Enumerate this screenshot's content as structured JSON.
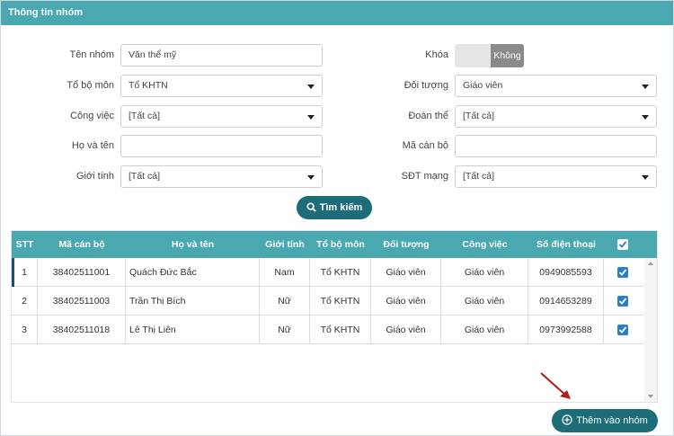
{
  "panel": {
    "title": "Thông tin nhóm"
  },
  "form": {
    "ten_nhom": {
      "label": "Tên nhóm",
      "value": "Văn thể mỹ"
    },
    "to_bo_mon": {
      "label": "Tổ bộ môn",
      "value": "Tổ KHTN"
    },
    "cong_viec": {
      "label": "Công việc",
      "value": "[Tất cả]"
    },
    "ho_va_ten": {
      "label": "Họ và tên",
      "value": ""
    },
    "gioi_tinh": {
      "label": "Giới tính",
      "value": "[Tất cả]"
    },
    "khoa": {
      "label": "Khóa",
      "toggle_text": "Không"
    },
    "doi_tuong": {
      "label": "Đối tượng",
      "value": "Giáo viên"
    },
    "doan_the": {
      "label": "Đoàn thể",
      "value": "[Tất cả]"
    },
    "ma_can_bo": {
      "label": "Mã cán bộ",
      "value": ""
    },
    "sdt_mang": {
      "label": "SĐT mạng",
      "value": "[Tất cả]"
    },
    "search_button": "Tìm kiếm"
  },
  "table": {
    "headers": [
      "STT",
      "Mã cán bộ",
      "Họ và tên",
      "Giới tính",
      "Tổ bộ môn",
      "Đối tượng",
      "Công việc",
      "Số điện thoại"
    ],
    "rows": [
      {
        "stt": "1",
        "ma": "38402511001",
        "ten": "Quách Đức Bắc",
        "gioi_tinh": "Nam",
        "to": "Tổ KHTN",
        "doi_tuong": "Giáo viên",
        "cong_viec": "Giáo viên",
        "sdt": "0949085593",
        "checked": true
      },
      {
        "stt": "2",
        "ma": "38402511003",
        "ten": "Trần Thị Bích",
        "gioi_tinh": "Nữ",
        "to": "Tổ KHTN",
        "doi_tuong": "Giáo viên",
        "cong_viec": "Giáo viên",
        "sdt": "0914653289",
        "checked": true
      },
      {
        "stt": "3",
        "ma": "38402511018",
        "ten": "Lê Thị Liên",
        "gioi_tinh": "Nữ",
        "to": "Tổ KHTN",
        "doi_tuong": "Giáo viên",
        "cong_viec": "Giáo viên",
        "sdt": "0973992588",
        "checked": true
      }
    ]
  },
  "add_button": "Thêm vào nhóm",
  "colors": {
    "header": "#4aa8b0",
    "button": "#1d6d78",
    "checkbox": "#2f7dc8",
    "arrow": "#b01c1c"
  }
}
